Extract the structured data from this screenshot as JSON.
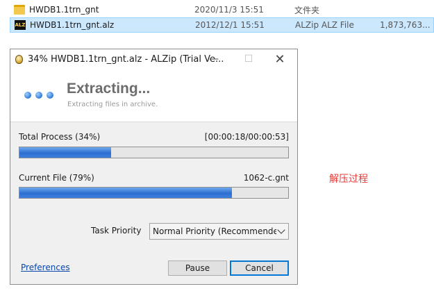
{
  "files": [
    {
      "name": "HWDB1.1trn_gnt",
      "date": "2020/11/3 15:51",
      "type": "文件夹",
      "size": "",
      "icon": "folder-icon",
      "selected": false
    },
    {
      "name": "HWDB1.1trn_gnt.alz",
      "date": "2012/12/1 15:51",
      "type": "ALZip ALZ File",
      "size": "1,873,763...",
      "icon": "alz-file-icon",
      "selected": true
    }
  ],
  "dialog": {
    "title": "34% HWDB1.1trn_gnt.alz - ALZip (Trial Ve...",
    "window_buttons": {
      "minimize": "—",
      "maximize": "☐",
      "close": "✕"
    },
    "heading": "Extracting...",
    "subheading": "Extracting files in archive.",
    "total": {
      "label": "Total Process (34%)",
      "time": "[00:00:18/00:00:53]",
      "progress": 0.34
    },
    "current": {
      "label": "Current File (79%)",
      "file": "1062-c.gnt",
      "progress": 0.79
    },
    "priority": {
      "label": "Task Priority",
      "value": "Normal Priority (Recommende"
    },
    "preferences_link": "Preferences",
    "pause_label": "Pause",
    "cancel_label": "Cancel"
  },
  "annotation": "解压过程",
  "colors": {
    "accent": "#0078d7",
    "progress": "#2d6fd0",
    "selection": "#cce8ff",
    "annotation": "#e53935"
  }
}
